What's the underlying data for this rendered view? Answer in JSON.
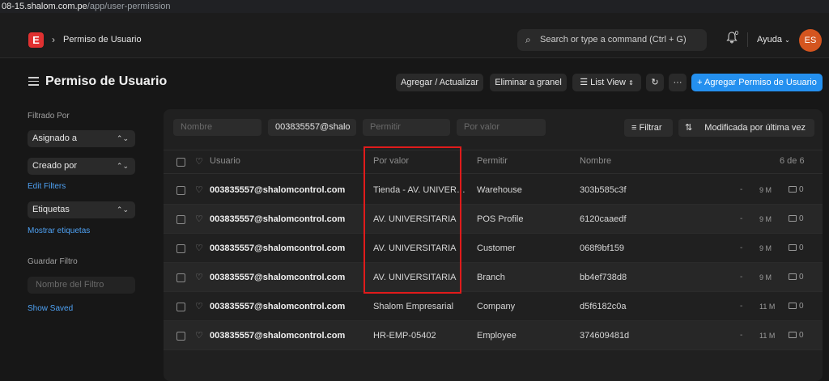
{
  "browser": {
    "url_host": "08-15.shalom.com.pe",
    "url_path": "/app/user-permission"
  },
  "navbar": {
    "logo_letter": "E",
    "breadcrumb": "Permiso de Usuario",
    "search_placeholder": "Search or type a command (Ctrl + G)",
    "notification_count": "0",
    "help_label": "Ayuda",
    "avatar_initials": "ES",
    "avatar_color": "#d4551f"
  },
  "page": {
    "title": "Permiso de Usuario",
    "actions": {
      "add_update": "Agregar / Actualizar",
      "bulk_delete": "Eliminar a granel",
      "view": "List View",
      "primary": "+ Agregar Permiso de Usuario"
    }
  },
  "sidebar": {
    "filter_by": "Filtrado Por",
    "assigned_to": "Asignado a",
    "created_by": "Creado por",
    "edit_filters": "Edit Filters",
    "tags": "Etiquetas",
    "show_tags": "Mostrar etiquetas",
    "save_filter": "Guardar Filtro",
    "filter_name_placeholder": "Nombre del Filtro",
    "show_saved": "Show Saved"
  },
  "filters": {
    "name_placeholder": "Nombre",
    "user_value": "003835557@shalo",
    "allow_placeholder": "Permitir",
    "for_value_placeholder": "Por valor",
    "filter_button": "Filtrar",
    "sort_label": "Modificada por última vez"
  },
  "table": {
    "headers": {
      "user": "Usuario",
      "for_value": "Por valor",
      "allow": "Permitir",
      "name": "Nombre",
      "count": "6 de 6"
    },
    "rows": [
      {
        "user": "003835557@shalomcontrol.com",
        "for_value": "Tienda - AV. UNIVERSITARIA",
        "allow": "Warehouse",
        "name": "303b585c3f",
        "dash": "-",
        "time": "9 M",
        "comments": "0"
      },
      {
        "user": "003835557@shalomcontrol.com",
        "for_value": "AV. UNIVERSITARIA",
        "allow": "POS Profile",
        "name": "6120caaedf",
        "dash": "-",
        "time": "9 M",
        "comments": "0"
      },
      {
        "user": "003835557@shalomcontrol.com",
        "for_value": "AV. UNIVERSITARIA",
        "allow": "Customer",
        "name": "068f9bf159",
        "dash": "-",
        "time": "9 M",
        "comments": "0"
      },
      {
        "user": "003835557@shalomcontrol.com",
        "for_value": "AV. UNIVERSITARIA",
        "allow": "Branch",
        "name": "bb4ef738d8",
        "dash": "-",
        "time": "9 M",
        "comments": "0"
      },
      {
        "user": "003835557@shalomcontrol.com",
        "for_value": "Shalom Empresarial",
        "allow": "Company",
        "name": "d5f6182c0a",
        "dash": "-",
        "time": "11 M",
        "comments": "0"
      },
      {
        "user": "003835557@shalomcontrol.com",
        "for_value": "HR-EMP-05402",
        "allow": "Employee",
        "name": "374609481d",
        "dash": "-",
        "time": "11 M",
        "comments": "0"
      }
    ]
  },
  "highlight_color": "#e01b1b"
}
